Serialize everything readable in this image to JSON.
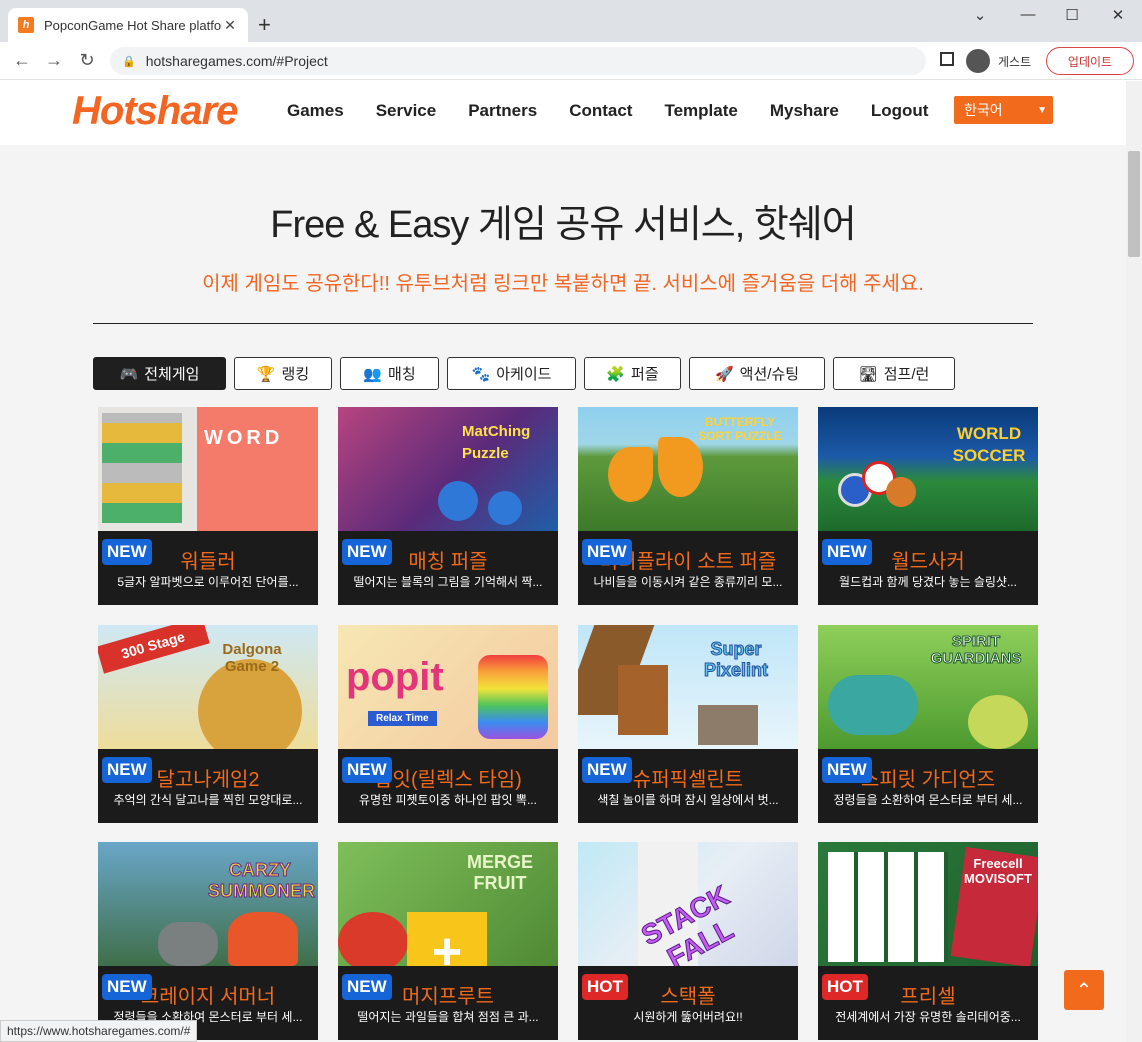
{
  "browser": {
    "tab_title": "PopconGame Hot Share platform",
    "url": "hotsharegames.com/#Project",
    "guest_label": "게스트",
    "update_label": "업데이트",
    "status_url": "https://www.hotsharegames.com/#"
  },
  "header": {
    "logo": "Hotshare",
    "menu": [
      "Games",
      "Service",
      "Partners",
      "Contact",
      "Template",
      "Myshare",
      "Logout"
    ],
    "language": "한국어"
  },
  "hero": {
    "title": "Free & Easy 게임 공유 서비스, 핫쉐어",
    "subtitle": "이제 게임도 공유한다!! 유투브처럼 링크만 복붙하면 끝. 서비스에 즐거움을 더해 주세요."
  },
  "filters": [
    {
      "label": "전체게임",
      "icon": "gamepad-icon"
    },
    {
      "label": "랭킹",
      "icon": "trophy-icon"
    },
    {
      "label": "매칭",
      "icon": "users-icon"
    },
    {
      "label": "아케이드",
      "icon": "paw-icon"
    },
    {
      "label": "퍼즐",
      "icon": "puzzle-icon"
    },
    {
      "label": "액션/슈팅",
      "icon": "rocket-icon"
    },
    {
      "label": "점프/런",
      "icon": "road-icon"
    }
  ],
  "games": [
    {
      "title": "워들러",
      "badge": "NEW",
      "desc": "5글자 알파벳으로 이루어진 단어를..."
    },
    {
      "title": "매칭 퍼즐",
      "badge": "NEW",
      "desc": "떨어지는 블록의 그림을 기억해서 짝..."
    },
    {
      "title": "버터플라이 소트 퍼즐",
      "badge": "NEW",
      "desc": "나비들을 이동시켜 같은 종류끼리 모..."
    },
    {
      "title": "월드사커",
      "badge": "NEW",
      "desc": "월드컵과 함께 당겼다 놓는 슬링샷..."
    },
    {
      "title": "달고나게임2",
      "badge": "NEW",
      "desc": "추억의 간식 달고나를 찍힌 모양대로..."
    },
    {
      "title": "팝잇(릴렉스 타임)",
      "badge": "NEW",
      "desc": "유명한 피젯토이중 하나인 팝잇 뽁..."
    },
    {
      "title": "슈퍼픽셀린트",
      "badge": "NEW",
      "desc": "색칠 놀이를 하며 잠시 일상에서 벗..."
    },
    {
      "title": "스피릿 가디언즈",
      "badge": "NEW",
      "desc": "정령들을 소환하여 몬스터로 부터 세..."
    },
    {
      "title": "크레이지 서머너",
      "badge": "NEW",
      "desc": "정령들을 소환하여 몬스터로 부터 세..."
    },
    {
      "title": "머지프루트",
      "badge": "NEW",
      "desc": "떨어지는 과일들을 합쳐 점점 큰 과..."
    },
    {
      "title": "스택폴",
      "badge": "HOT",
      "desc": "시원하게 뚫어버려요!!"
    },
    {
      "title": "프리셀",
      "badge": "HOT",
      "desc": "전세계에서 가장 유명한 솔리테어중..."
    }
  ],
  "thumb_texts": {
    "word": "WORD",
    "matching": "MatChing Puzzle",
    "butterfly": "BUTTERFLY SORT PUZZLE",
    "soccer": "WORLD SOCCER",
    "dalgona": "Dalgona Game 2",
    "dalgona_stage": "300 Stage",
    "popit": "popit",
    "popit_sub": "Relax Time",
    "pixel": "Super Pixelint",
    "spirit": "SPIRIT GUARDIANS",
    "crazy": "CARZY SUMMONER",
    "merge": "MERGE FRUIT",
    "stack": "STACK FALL",
    "freecell": "Freecell MOVISOFT"
  }
}
